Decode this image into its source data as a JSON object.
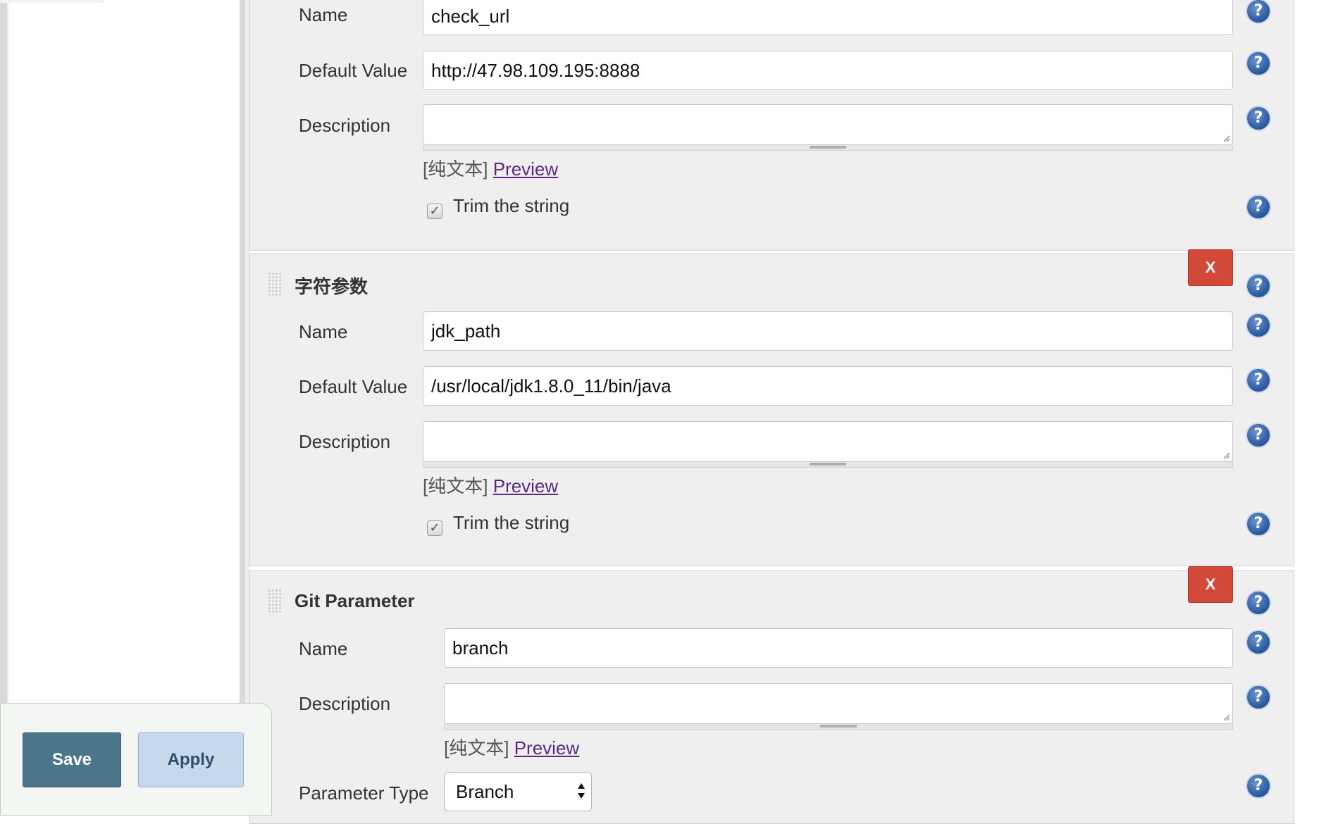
{
  "section_string_1": {
    "name_label": "Name",
    "name_value": "check_url",
    "default_label": "Default Value",
    "default_value": "http://47.98.109.195:8888",
    "description_label": "Description",
    "description_value": "",
    "format_hint": "[纯文本]",
    "preview_link": "Preview",
    "trim_label": "Trim the string",
    "trim_checked": "✓"
  },
  "section_string_2": {
    "title": "字符参数",
    "delete_label": "X",
    "name_label": "Name",
    "name_value": "jdk_path",
    "default_label": "Default Value",
    "default_value": "/usr/local/jdk1.8.0_11/bin/java",
    "description_label": "Description",
    "description_value": "",
    "format_hint": "[纯文本]",
    "preview_link": "Preview",
    "trim_label": "Trim the string",
    "trim_checked": "✓"
  },
  "section_git": {
    "title": "Git Parameter",
    "delete_label": "X",
    "name_label": "Name",
    "name_value": "branch",
    "description_label": "Description",
    "description_value": "",
    "format_hint": "[纯文本]",
    "preview_link": "Preview",
    "type_label": "Parameter Type",
    "type_value": "Branch"
  },
  "help_icon_glyph": "?",
  "footer": {
    "save_label": "Save",
    "apply_label": "Apply"
  }
}
